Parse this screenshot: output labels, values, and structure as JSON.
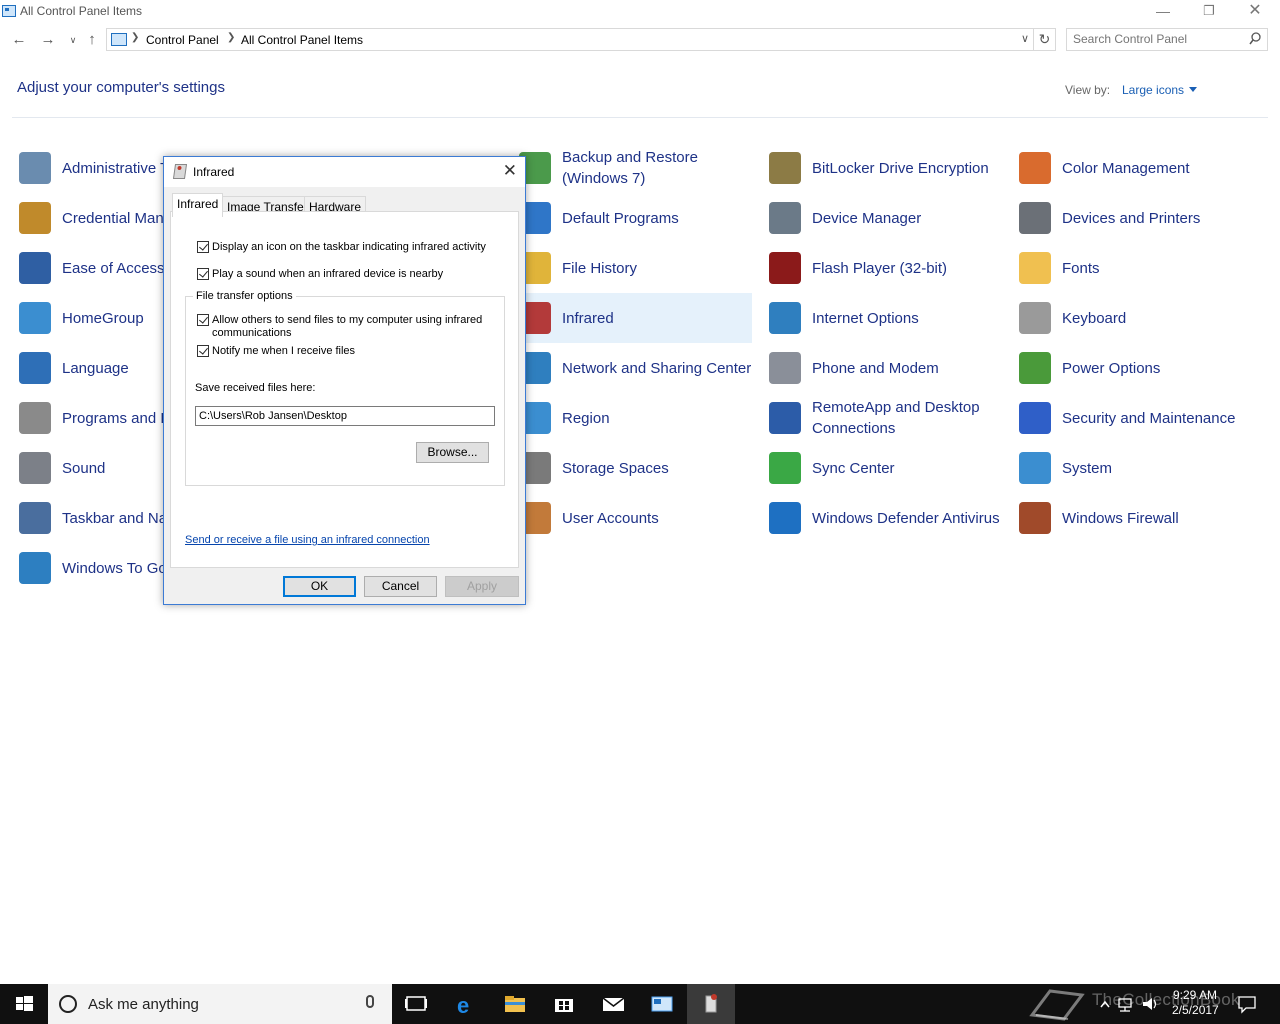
{
  "window": {
    "title": "All Control Panel Items"
  },
  "address": {
    "crumbs": [
      "Control Panel",
      "All Control Panel Items"
    ]
  },
  "search": {
    "placeholder": "Search Control Panel"
  },
  "header": {
    "title": "Adjust your computer's settings",
    "view_by_label": "View by:",
    "view_by_value": "Large icons"
  },
  "items": [
    {
      "label": "Administrative Tools",
      "icon": "administrative-tools-icon"
    },
    {
      "label": "Credential Manager",
      "icon": "credential-manager-icon"
    },
    {
      "label": "Ease of Access Center",
      "icon": "ease-of-access-icon"
    },
    {
      "label": "HomeGroup",
      "icon": "homegroup-icon"
    },
    {
      "label": "Language",
      "icon": "language-icon"
    },
    {
      "label": "Programs and Features",
      "icon": "programs-features-icon"
    },
    {
      "label": "Sound",
      "icon": "sound-icon"
    },
    {
      "label": "Taskbar and Navigation",
      "icon": "taskbar-navigation-icon"
    },
    {
      "label": "Windows To Go",
      "icon": "windows-to-go-icon"
    },
    {
      "label": "Backup and Restore (Windows 7)",
      "icon": "backup-restore-icon"
    },
    {
      "label": "Default Programs",
      "icon": "default-programs-icon"
    },
    {
      "label": "File History",
      "icon": "file-history-icon"
    },
    {
      "label": "Infrared",
      "icon": "infrared-icon"
    },
    {
      "label": "Network and Sharing Center",
      "icon": "network-sharing-icon"
    },
    {
      "label": "Region",
      "icon": "region-icon"
    },
    {
      "label": "Storage Spaces",
      "icon": "storage-spaces-icon"
    },
    {
      "label": "User Accounts",
      "icon": "user-accounts-icon"
    },
    {
      "label": "BitLocker Drive Encryption",
      "icon": "bitlocker-icon"
    },
    {
      "label": "Device Manager",
      "icon": "device-manager-icon"
    },
    {
      "label": "Flash Player (32-bit)",
      "icon": "flash-player-icon"
    },
    {
      "label": "Internet Options",
      "icon": "internet-options-icon"
    },
    {
      "label": "Phone and Modem",
      "icon": "phone-modem-icon"
    },
    {
      "label": "RemoteApp and Desktop Connections",
      "icon": "remoteapp-icon"
    },
    {
      "label": "Sync Center",
      "icon": "sync-center-icon"
    },
    {
      "label": "Windows Defender Antivirus",
      "icon": "windows-defender-icon"
    },
    {
      "label": "Color Management",
      "icon": "color-management-icon"
    },
    {
      "label": "Devices and Printers",
      "icon": "devices-printers-icon"
    },
    {
      "label": "Fonts",
      "icon": "fonts-icon"
    },
    {
      "label": "Keyboard",
      "icon": "keyboard-icon"
    },
    {
      "label": "Power Options",
      "icon": "power-options-icon"
    },
    {
      "label": "Security and Maintenance",
      "icon": "security-maintenance-icon"
    },
    {
      "label": "System",
      "icon": "system-icon"
    },
    {
      "label": "Windows Firewall",
      "icon": "windows-firewall-icon"
    }
  ],
  "dialog": {
    "title": "Infrared",
    "tabs": [
      "Infrared",
      "Image Transfer",
      "Hardware"
    ],
    "options": {
      "display_icon": "Display an icon on the taskbar indicating infrared activity",
      "play_sound": "Play a sound when an infrared device is nearby"
    },
    "group_label": "File transfer options",
    "allow_others": "Allow others to send files to my computer using infrared communications",
    "notify": "Notify me when I receive files",
    "save_label": "Save received files here:",
    "save_path": "C:\\Users\\Rob Jansen\\Desktop",
    "browse": "Browse...",
    "link": "Send or receive a file using an infrared connection",
    "ok": "OK",
    "cancel": "Cancel",
    "apply": "Apply"
  },
  "taskbar": {
    "search_placeholder": "Ask me anything",
    "time": "9:29 AM",
    "date": "2/5/2017",
    "watermark": "TheCollectionBook"
  },
  "colors": {
    "link": "#1e3287",
    "accent": "#0078d7",
    "selection": "#e5f1fb"
  }
}
